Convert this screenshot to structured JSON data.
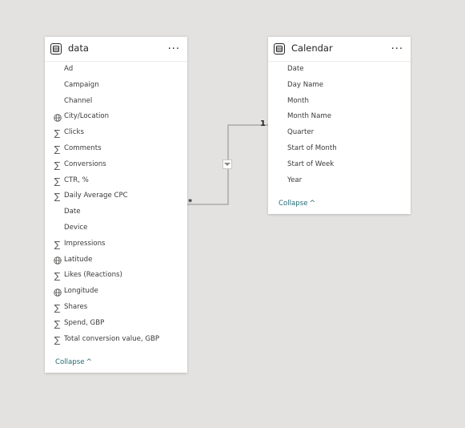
{
  "tables": [
    {
      "title": "data",
      "more_label": "...",
      "collapse_label": "Collapse",
      "fields": [
        {
          "label": "Ad",
          "icon": ""
        },
        {
          "label": "Campaign",
          "icon": ""
        },
        {
          "label": "Channel",
          "icon": ""
        },
        {
          "label": "City/Location",
          "icon": "globe-icon"
        },
        {
          "label": "Clicks",
          "icon": "sigma-icon"
        },
        {
          "label": "Comments",
          "icon": "sigma-icon"
        },
        {
          "label": "Conversions",
          "icon": "sigma-icon"
        },
        {
          "label": "CTR, %",
          "icon": "sigma-icon"
        },
        {
          "label": "Daily Average CPC",
          "icon": "sigma-icon"
        },
        {
          "label": "Date",
          "icon": ""
        },
        {
          "label": "Device",
          "icon": ""
        },
        {
          "label": "Impressions",
          "icon": "sigma-icon"
        },
        {
          "label": "Latitude",
          "icon": "globe-icon"
        },
        {
          "label": "Likes (Reactions)",
          "icon": "sigma-icon"
        },
        {
          "label": "Longitude",
          "icon": "globe-icon"
        },
        {
          "label": "Shares",
          "icon": "sigma-icon"
        },
        {
          "label": "Spend, GBP",
          "icon": "sigma-icon"
        },
        {
          "label": "Total conversion value, GBP",
          "icon": "sigma-icon"
        }
      ]
    },
    {
      "title": "Calendar",
      "more_label": "...",
      "collapse_label": "Collapse",
      "fields": [
        {
          "label": "Date",
          "icon": ""
        },
        {
          "label": "Day Name",
          "icon": ""
        },
        {
          "label": "Month",
          "icon": ""
        },
        {
          "label": "Month Name",
          "icon": ""
        },
        {
          "label": "Quarter",
          "icon": ""
        },
        {
          "label": "Start of Month",
          "icon": ""
        },
        {
          "label": "Start of Week",
          "icon": ""
        },
        {
          "label": "Year",
          "icon": ""
        }
      ]
    }
  ],
  "relationship": {
    "many_label": "*",
    "one_label": "1",
    "filter_direction": "single"
  },
  "colors": {
    "canvas": "#e3e2e0",
    "card": "#ffffff",
    "line": "#a19f9d",
    "collapse_link": "#1f6b75"
  }
}
